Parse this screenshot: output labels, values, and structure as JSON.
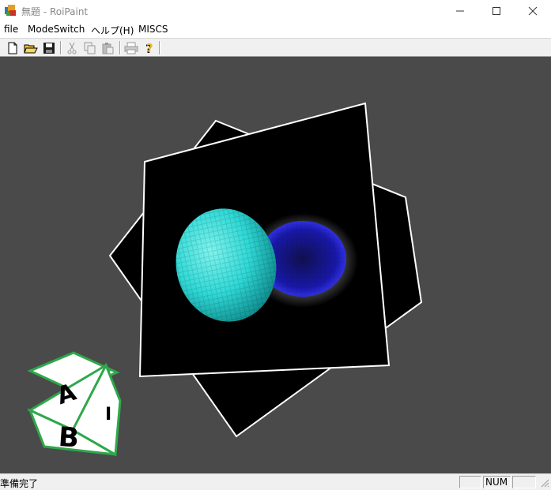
{
  "window": {
    "title": "無題 - RoiPaint"
  },
  "menu": [
    {
      "label": "file"
    },
    {
      "label": "ModeSwitch"
    },
    {
      "label": "ヘルプ(H)"
    },
    {
      "label": "MISCS"
    }
  ],
  "toolbar": {
    "buttons": [
      "new-file-icon",
      "open-folder-icon",
      "save-disk-icon",
      "cut-scissors-icon",
      "copy-icon",
      "paste-icon",
      "print-icon",
      "help-question-icon"
    ]
  },
  "cube": {
    "face_a": "A",
    "face_b": "B",
    "face_side": "I"
  },
  "statusbar": {
    "message": "準備完了",
    "num": "NUM"
  },
  "colors": {
    "viewport_bg": "#4a4a4a",
    "cyan_blob": "#2fd9d6",
    "blue_blob": "#2222cc",
    "cube_edge": "#2ea84a"
  }
}
